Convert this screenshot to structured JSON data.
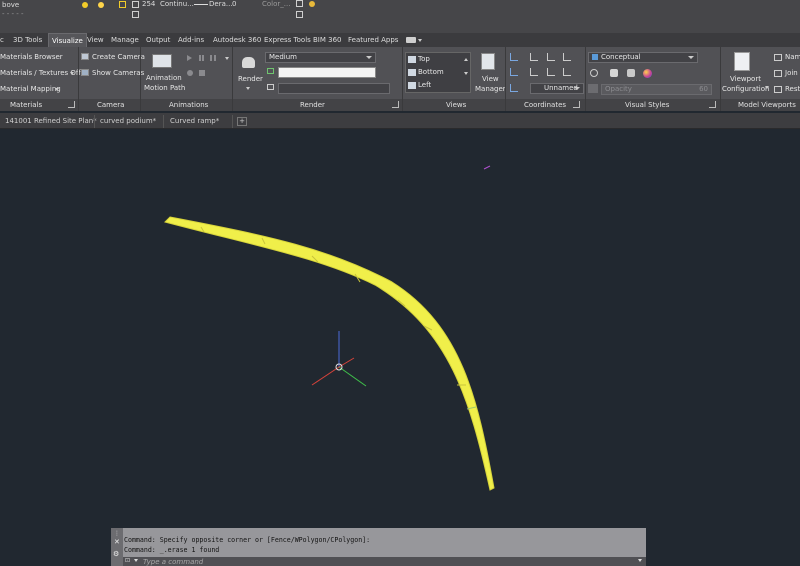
{
  "top_strip": {
    "layer_state": "bove",
    "items": [
      "254",
      "Continu...",
      "Dera...",
      "0",
      "Color_..."
    ]
  },
  "ribbon_tabs": [
    "c",
    "3D Tools",
    "Visualize",
    "View",
    "Manage",
    "Output",
    "Add-ins",
    "Autodesk 360",
    "Express Tools",
    "BIM 360",
    "Featured Apps"
  ],
  "active_tab": "Visualize",
  "panels": {
    "materials": {
      "title": "Materials",
      "items": [
        "Materials Browser",
        "Materials / Textures Off",
        "Material Mapping"
      ]
    },
    "camera": {
      "title": "Camera",
      "items": [
        "Create Camera",
        "Show Cameras"
      ]
    },
    "animations": {
      "title": "Animations",
      "button_line1": "Animation",
      "button_line2": "Motion Path"
    },
    "render": {
      "title": "Render",
      "button": "Render",
      "preset": "Medium"
    },
    "views": {
      "title": "Views",
      "items": [
        "Top",
        "Bottom",
        "Left"
      ],
      "manager_line1": "View",
      "manager_line2": "Manager"
    },
    "coordinates": {
      "title": "Coordinates",
      "ucs": "Unnamed"
    },
    "visual_styles": {
      "title": "Visual Styles",
      "style": "Conceptual",
      "opacity_label": "Opacity",
      "opacity_value": "60"
    },
    "model_viewports": {
      "title": "Model Viewports",
      "config_line1": "Viewport",
      "config_line2": "Configuration",
      "items": [
        "Nam",
        "Join",
        "Resto"
      ]
    }
  },
  "doc_tabs": [
    "141001 Refined Site Plan*",
    "curved podium*",
    "Curved ramp*"
  ],
  "drawing": {
    "background": "#212830",
    "ramp_color": "#f0ef4a",
    "ramp_edge_color": "#d7d43a"
  },
  "command": {
    "history": [
      "Command: Specify opposite corner or [Fence/WPolygon/CPolygon]:",
      "Command: _.erase 1 found"
    ],
    "placeholder": "Type a command"
  }
}
